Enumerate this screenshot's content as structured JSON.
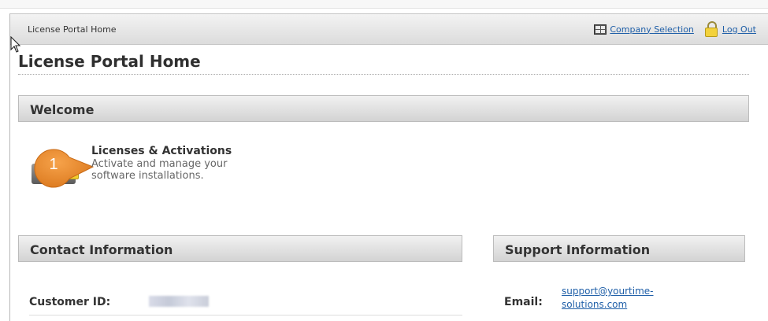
{
  "topbar": {
    "breadcrumb": "License Portal Home",
    "company_selection": "Company Selection",
    "logout": "Log Out"
  },
  "page": {
    "title": "License Portal Home"
  },
  "welcome": {
    "heading": "Welcome",
    "callout_number": "1",
    "licenses_title": "Licenses & Activations",
    "licenses_desc": "Activate and manage your software installations."
  },
  "contact": {
    "heading": "Contact Information",
    "customer_id_label": "Customer ID:",
    "customer_id_value": ""
  },
  "support": {
    "heading": "Support Information",
    "email_label": "Email:",
    "email_value": "support@yourtime-solutions.com"
  },
  "colors": {
    "link": "#1f5fa8",
    "callout": "#e98a2b",
    "header_gradient_top": "#f1f1f1",
    "header_gradient_bottom": "#d3d3d3"
  },
  "icons": [
    "grid-icon",
    "lock-icon",
    "license-icon",
    "cursor-icon"
  ]
}
